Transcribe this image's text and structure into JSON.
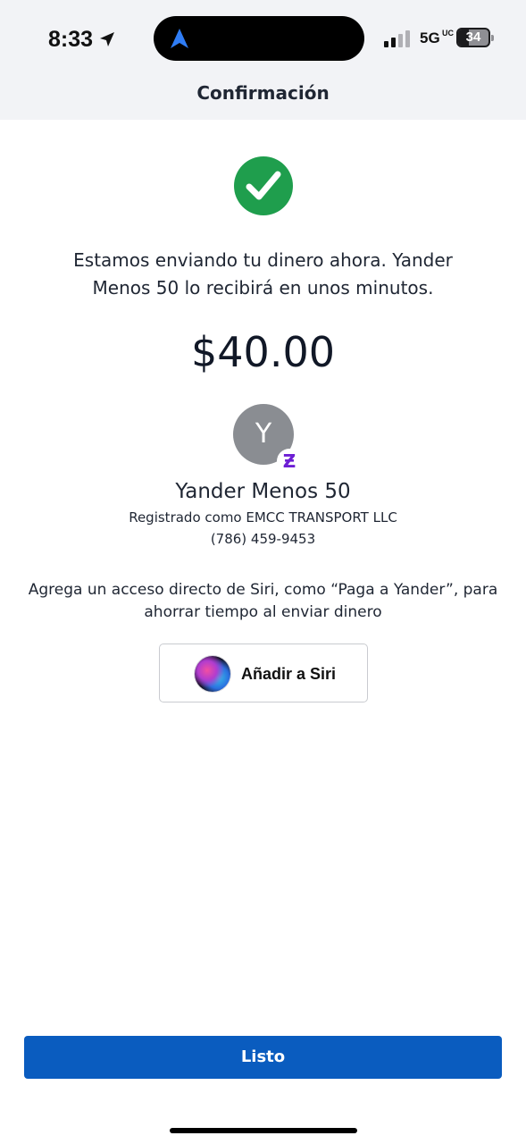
{
  "status_bar": {
    "time": "8:33",
    "network": "5G",
    "network_suffix": "UC",
    "battery_percent": "34",
    "battery_level": 0.34,
    "icons": [
      "location-arrow-icon",
      "navigation-arrow-icon",
      "signal-icon",
      "battery-icon"
    ]
  },
  "header": {
    "title": "Confirmación"
  },
  "confirmation": {
    "icon": "check-circle-icon",
    "message": "Estamos enviando tu dinero ahora. Yander Menos 50 lo recibirá en unos minutos.",
    "amount": "$40.00"
  },
  "recipient": {
    "avatar_initial": "Y",
    "badge": "Ƶ",
    "name": "Yander Menos 50",
    "registered_as": "Registrado como EMCC TRANSPORT LLC",
    "phone": "(786) 459-9453"
  },
  "siri": {
    "prompt": "Agrega un acceso directo de Siri, como “Paga a Yander”, para ahorrar tiempo al enviar dinero",
    "button_label": "Añadir a Siri",
    "icon": "siri-icon"
  },
  "footer": {
    "done_label": "Listo"
  },
  "colors": {
    "primary": "#0a5cbf",
    "success": "#1f9e4d",
    "zelle_purple": "#6d1ed4",
    "header_bg": "#f2f3f6"
  }
}
